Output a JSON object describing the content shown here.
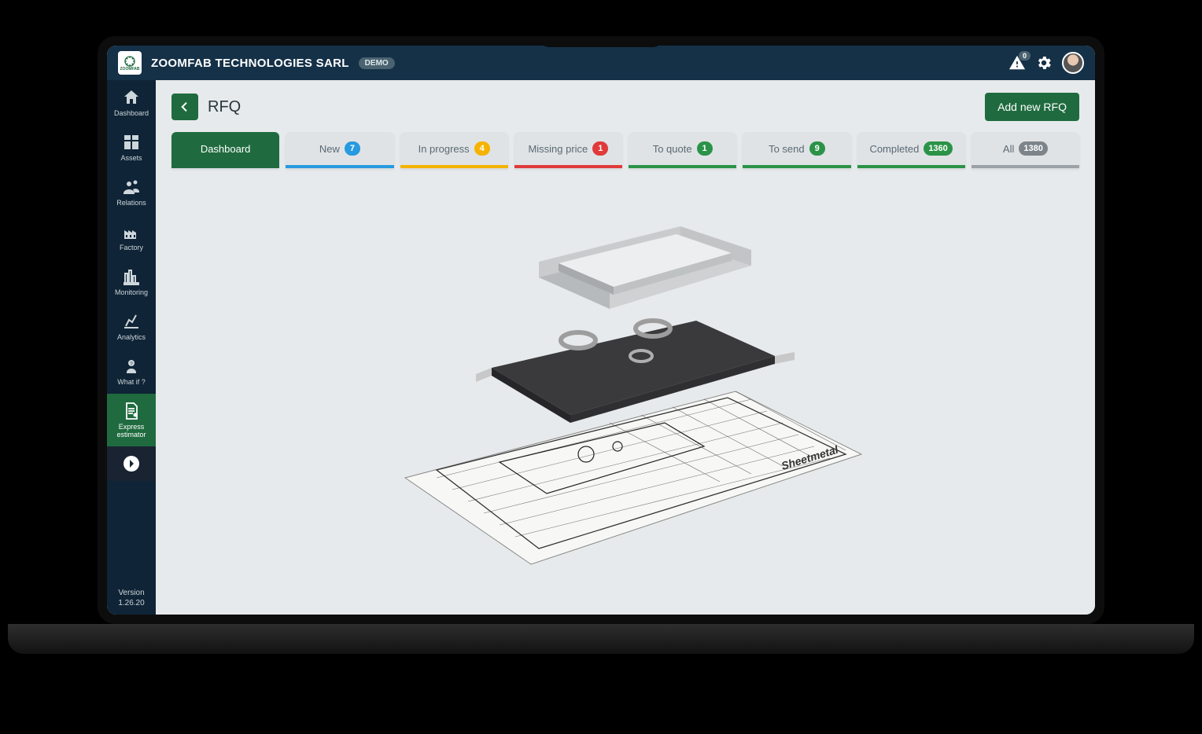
{
  "header": {
    "company": "ZOOMFAB TECHNOLOGIES SARL",
    "logo_text": "ZOOMFAB",
    "demo_badge": "DEMO",
    "notification_count": "0"
  },
  "sidebar": {
    "items": [
      {
        "label": "Dashboard"
      },
      {
        "label": "Assets"
      },
      {
        "label": "Relations"
      },
      {
        "label": "Factory"
      },
      {
        "label": "Monitoring"
      },
      {
        "label": "Analytics"
      },
      {
        "label": "What if ?"
      },
      {
        "label": "Express estimator"
      }
    ],
    "version_label": "Version",
    "version_value": "1.26.20"
  },
  "page": {
    "title": "RFQ",
    "add_button": "Add new RFQ"
  },
  "tabs": [
    {
      "label": "Dashboard",
      "count": null
    },
    {
      "label": "New",
      "count": "7"
    },
    {
      "label": "In progress",
      "count": "4"
    },
    {
      "label": "Missing price",
      "count": "1"
    },
    {
      "label": "To quote",
      "count": "1"
    },
    {
      "label": "To send",
      "count": "9"
    },
    {
      "label": "Completed",
      "count": "1360"
    },
    {
      "label": "All",
      "count": "1380"
    }
  ],
  "illustration_label": "Sheetmetal"
}
